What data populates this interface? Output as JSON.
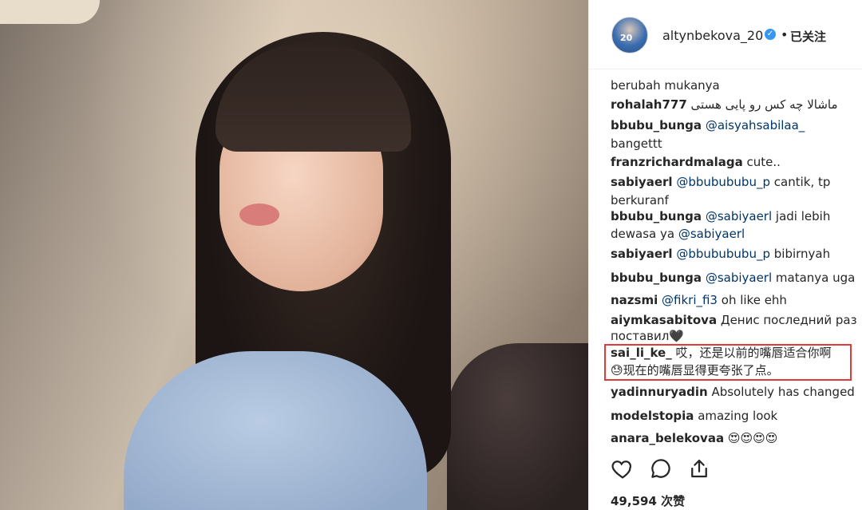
{
  "post": {
    "username": "altynbekova_20",
    "follow_label": "已关注",
    "avatar_text": "20",
    "likes": "49,594 次赞"
  },
  "comments": [
    {
      "user": "",
      "text": "berubah mukanya"
    },
    {
      "user": "rohalah777",
      "text": "ماشالا چه کس رو پایی هستی"
    },
    {
      "user": "bbubu_bunga",
      "mention": "@aisyahsabilaa_",
      "text": ""
    },
    {
      "user": "",
      "text": "bangettt"
    },
    {
      "user": "franzrichardmalaga",
      "text": "cute.."
    },
    {
      "user": "sabiyaerl",
      "mention": "@bbubububu_p",
      "text": "cantik, tp"
    },
    {
      "user": "",
      "text": "berkuranf"
    },
    {
      "user": "bbubu_bunga",
      "mention": "@sabiyaerl",
      "text": "jadi lebih"
    },
    {
      "user": "",
      "text": "dewasa ya",
      "mention": "@sabiyaerl"
    },
    {
      "user": "sabiyaerl",
      "mention": "@bbubububu_p",
      "text": "bibirnyah"
    },
    {
      "user": "bbubu_bunga",
      "mention": "@sabiyaerl",
      "text": "matanya uga"
    },
    {
      "user": "nazsmi",
      "mention": "@fikri_fi3",
      "text": "oh like ehh"
    },
    {
      "user": "aiymkasabitova",
      "text": "Денис последний раз"
    },
    {
      "user": "",
      "text": "поставил🖤"
    },
    {
      "user": "sai_li_ke_",
      "text": "哎，还是以前的嘴唇适合你啊"
    },
    {
      "user": "",
      "text": "😓现在的嘴唇显得更夸张了点。"
    },
    {
      "user": "yadinnuryadin",
      "text": "Absolutely has changed"
    },
    {
      "user": "modelstopia",
      "text": "amazing look"
    },
    {
      "user": "anara_belekovaa",
      "text": "😍😍😍😍"
    }
  ],
  "actions": {
    "like_icon": "heart-icon",
    "comment_icon": "comment-icon",
    "share_icon": "share-icon"
  },
  "colors": {
    "mention": "#003569",
    "highlight": "#e03b3b",
    "verified": "#3897f0"
  }
}
